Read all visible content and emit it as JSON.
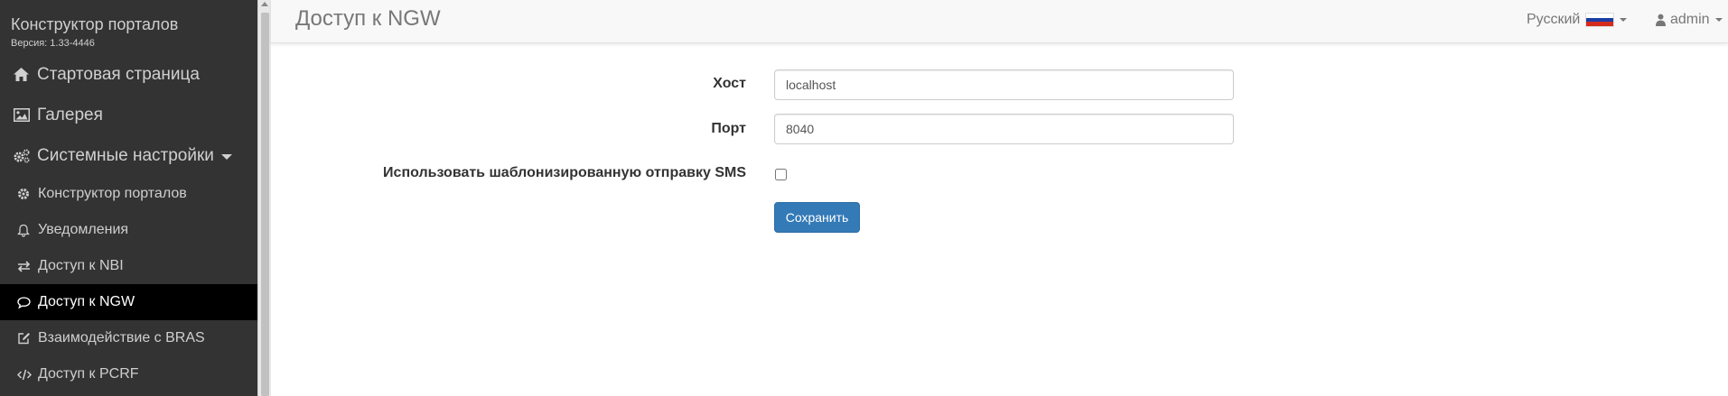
{
  "sidebar": {
    "brand_title": "Конструктор порталов",
    "brand_version": "Версия: 1.33-4446",
    "top_items": [
      {
        "label": "Стартовая страница",
        "icon": "home-icon"
      },
      {
        "label": "Галерея",
        "icon": "image-icon"
      },
      {
        "label": "Системные настройки",
        "icon": "gears-icon"
      }
    ],
    "sub_items": [
      {
        "label": "Конструктор порталов",
        "icon": "gear-icon"
      },
      {
        "label": "Уведомления",
        "icon": "bell-icon"
      },
      {
        "label": "Доступ к NBI",
        "icon": "exchange-icon"
      },
      {
        "label": "Доступ к NGW",
        "icon": "comment-icon",
        "active": true
      },
      {
        "label": "Взаимодействие с BRAS",
        "icon": "edit-icon"
      },
      {
        "label": "Доступ к PCRF",
        "icon": "code-icon"
      }
    ]
  },
  "header": {
    "title": "Доступ к NGW",
    "language": "Русский",
    "user": "admin"
  },
  "form": {
    "host_label": "Хост",
    "host_value": "localhost",
    "port_label": "Порт",
    "port_value": "8040",
    "sms_label": "Использовать шаблонизированную отправку SMS",
    "sms_checked": false,
    "save_label": "Сохранить"
  },
  "colors": {
    "sidebar_bg": "#333333",
    "active_item_bg": "#000000",
    "header_bg": "#f8f8f8",
    "primary": "#337ab7"
  }
}
